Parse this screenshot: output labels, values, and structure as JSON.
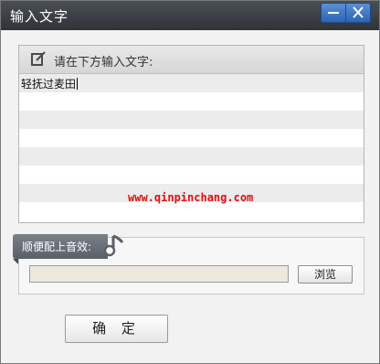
{
  "window": {
    "title": "输入文字"
  },
  "text_panel": {
    "header_label": "请在下方输入文字:",
    "entered_text": "轻抚过麦田",
    "watermark": "www.qinpinchang.com"
  },
  "music": {
    "label": "顺便配上音效:",
    "file_value": "",
    "browse_label": "浏览"
  },
  "footer": {
    "ok_label": "确 定"
  },
  "colors": {
    "titlebar": "#3a3e44",
    "window_button": "#3a74c4",
    "watermark": "#e01010",
    "file_input_bg": "#ece9de"
  },
  "icons": {
    "minimize": "minimize-icon",
    "close": "close-icon",
    "edit": "edit-icon",
    "music": "music-note-icon"
  }
}
